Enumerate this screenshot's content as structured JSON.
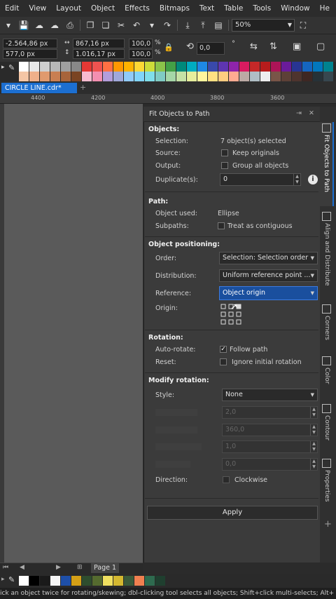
{
  "menu": [
    "Edit",
    "View",
    "Layout",
    "Object",
    "Effects",
    "Bitmaps",
    "Text",
    "Table",
    "Tools",
    "Window",
    "He"
  ],
  "toolbar": {
    "zoom": "50%"
  },
  "propbar": {
    "x": "-2.564,86 px",
    "y": "577,0 px",
    "w": "867,16 px",
    "h": "1.016,17 px",
    "sx": "100,0",
    "sy": "100,0",
    "pct": "%",
    "angle": "0,0",
    "deg": "°"
  },
  "colors": {
    "accent": "#1c6fd1",
    "palette_row1": [
      "#ffffff",
      "#e8e8e8",
      "#d0d0d0",
      "#b8b8b8",
      "#a0a0a0",
      "#888888",
      "#e53935",
      "#ef5350",
      "#ff7043",
      "#ff9800",
      "#ffb300",
      "#fdd835",
      "#cddc39",
      "#8bc34a",
      "#43a047",
      "#00897b",
      "#00acc1",
      "#1e88e5",
      "#3949ab",
      "#5e35b1",
      "#8e24aa",
      "#d81b60",
      "#c62828",
      "#b71c1c",
      "#ad1457",
      "#6a1b9a",
      "#283593",
      "#1565c0",
      "#0277bd",
      "#00838f"
    ],
    "palette_row2": [
      "#f5c6a5",
      "#efb08a",
      "#e09a6e",
      "#c97f52",
      "#a8643a",
      "#7a4422",
      "#f8bbd0",
      "#f48fb1",
      "#b39ddb",
      "#9fa8da",
      "#90caf9",
      "#81d4fa",
      "#80deea",
      "#80cbc4",
      "#a5d6a7",
      "#c5e1a5",
      "#e6ee9c",
      "#fff59d",
      "#ffe082",
      "#ffcc80",
      "#ffab91",
      "#bcaaa4",
      "#b0bec5",
      "#eeeeee",
      "#795548",
      "#5d4037",
      "#4e342e",
      "#3e2723",
      "#263238",
      "#37474f"
    ],
    "bottom_palette": [
      "#ffffff",
      "#000000",
      "#1a1a1a",
      "#f5f5f5",
      "#1e4fa8",
      "#d4a017",
      "#2e4d2e",
      "#556b2f",
      "#f0e060",
      "#d4b830",
      "#3a5a3a",
      "#f08050",
      "#2e6b4f",
      "#1f3f2f"
    ]
  },
  "document": {
    "tab": "CIRCLE LINE.cdr*"
  },
  "ruler": [
    "4400",
    "4200",
    "4000",
    "3800",
    "3600"
  ],
  "docker": {
    "title": "Fit Objects to Path",
    "objects": {
      "heading": "Objects:",
      "selection_label": "Selection:",
      "selection_value": "7 object(s) selected",
      "source_label": "Source:",
      "source_option": "Keep originals",
      "source_checked": false,
      "output_label": "Output:",
      "output_option": "Group all objects",
      "output_checked": false,
      "duplicates_label": "Duplicate(s):",
      "duplicates_value": "0"
    },
    "path": {
      "heading": "Path:",
      "object_used_label": "Object used:",
      "object_used_value": "Ellipse",
      "subpaths_label": "Subpaths:",
      "subpaths_option": "Treat as contiguous",
      "subpaths_checked": false
    },
    "positioning": {
      "heading": "Object positioning:",
      "order_label": "Order:",
      "order_value": "Selection: Selection order",
      "distribution_label": "Distribution:",
      "distribution_value": "Uniform reference point ...",
      "reference_label": "Reference:",
      "reference_value": "Object origin",
      "origin_label": "Origin:"
    },
    "rotation": {
      "heading": "Rotation:",
      "autorotate_label": "Auto-rotate:",
      "autorotate_option": "Follow path",
      "autorotate_checked": true,
      "reset_label": "Reset:",
      "reset_option": "Ignore initial rotation",
      "reset_checked": false
    },
    "modify": {
      "heading": "Modify rotation:",
      "style_label": "Style:",
      "style_value": "None",
      "field1": "2,0",
      "field2": "360,0",
      "field3": "1,0",
      "field4": "0,0",
      "direction_label": "Direction:",
      "direction_option": "Clockwise",
      "direction_checked": false
    },
    "apply": "Apply"
  },
  "side_tabs": [
    "Fit Objects to Path",
    "Align and Distribute",
    "Corners",
    "Color",
    "Contour",
    "Properties"
  ],
  "page_tab": "Page 1",
  "status": "ick an object twice for rotating/skewing; dbl-clicking tool selects all objects; Shift+click multi-selects; Alt+"
}
